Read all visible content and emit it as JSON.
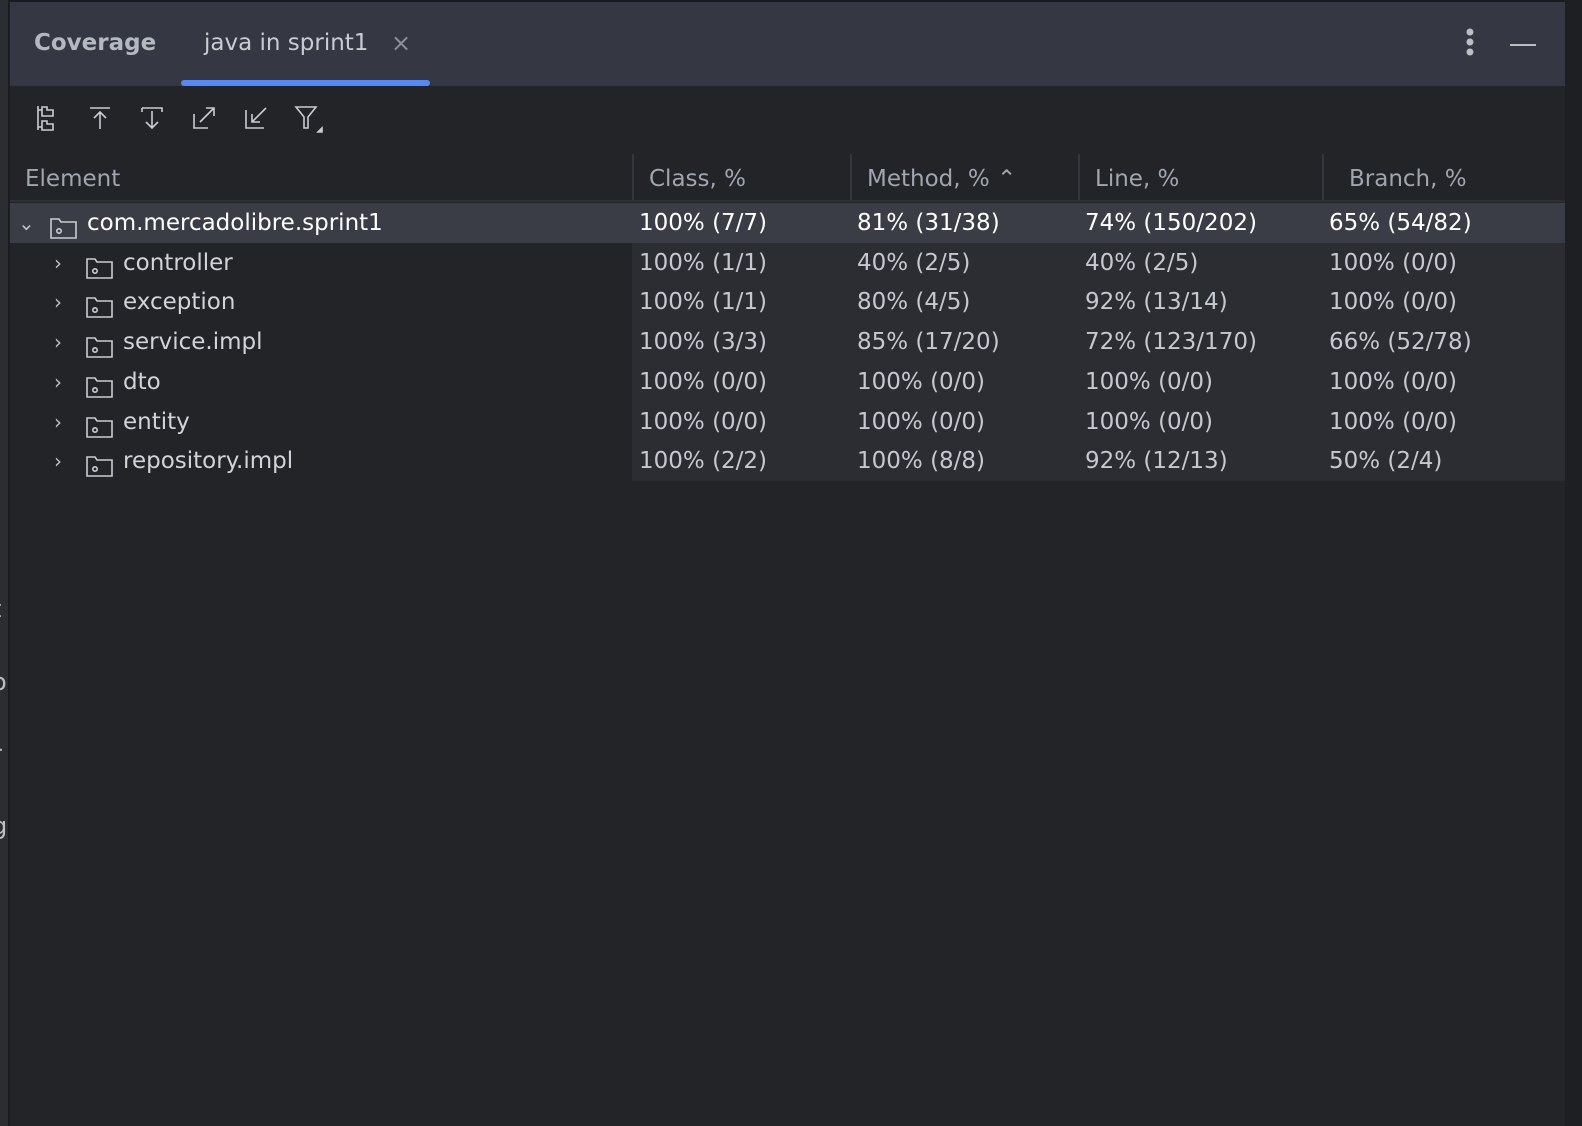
{
  "background_fragments": [
    "t",
    "o",
    "r",
    "g"
  ],
  "tabbar": {
    "title": "Coverage",
    "active_tab": "java in sprint1",
    "close_glyph": "×",
    "more_glyph": "⋮"
  },
  "toolbar": {
    "icons": [
      "flatten-packages-icon",
      "go-to-parent-icon",
      "go-to-child-icon",
      "export-icon",
      "import-icon",
      "filter-icon"
    ]
  },
  "columns": [
    "Element",
    "Class, %",
    "Method, % ⌃",
    "Line, %",
    "Branch, %"
  ],
  "rows": [
    {
      "name": "com.mercadolibre.sprint1",
      "expanded": true,
      "chev": "⌄",
      "class": "100% (7/7)",
      "method": "81% (31/38)",
      "line": "74% (150/202)",
      "branch": "65% (54/82)"
    },
    {
      "name": "controller",
      "chev": "›",
      "class": "100% (1/1)",
      "method": "40% (2/5)",
      "line": "40% (2/5)",
      "branch": "100% (0/0)"
    },
    {
      "name": "exception",
      "chev": "›",
      "class": "100% (1/1)",
      "method": "80% (4/5)",
      "line": "92% (13/14)",
      "branch": "100% (0/0)"
    },
    {
      "name": "service.impl",
      "chev": "›",
      "class": "100% (3/3)",
      "method": "85% (17/20)",
      "line": "72% (123/170)",
      "branch": "66% (52/78)"
    },
    {
      "name": "dto",
      "chev": "›",
      "class": "100% (0/0)",
      "method": "100% (0/0)",
      "line": "100% (0/0)",
      "branch": "100% (0/0)"
    },
    {
      "name": "entity",
      "chev": "›",
      "class": "100% (0/0)",
      "method": "100% (0/0)",
      "line": "100% (0/0)",
      "branch": "100% (0/0)"
    },
    {
      "name": "repository.impl",
      "chev": "›",
      "class": "100% (2/2)",
      "method": "100% (8/8)",
      "line": "92% (12/13)",
      "branch": "50% (2/4)"
    }
  ]
}
